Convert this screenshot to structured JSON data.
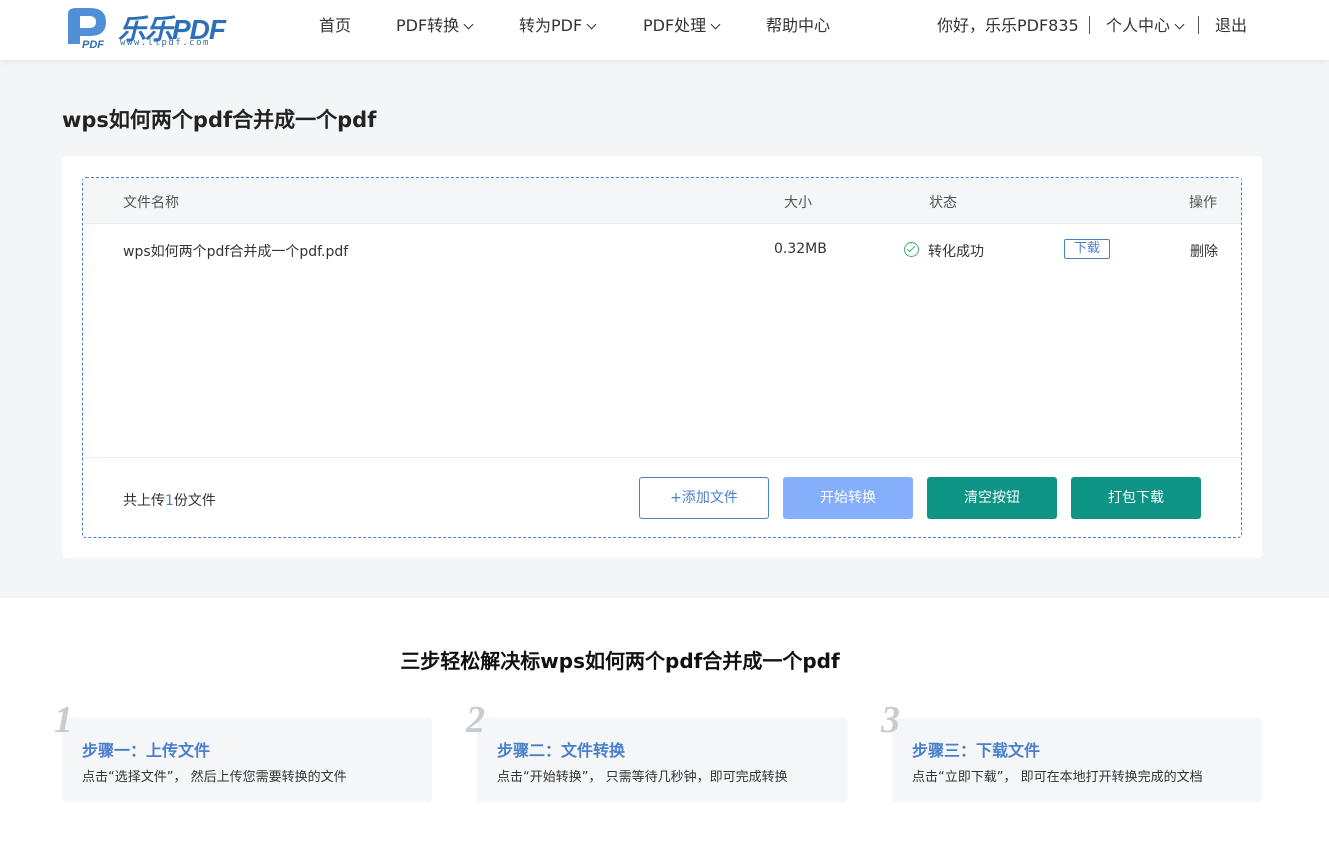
{
  "header": {
    "logo": {
      "text": "乐乐PDF",
      "url_text": "www.llpdf.com",
      "color": "#2d6fb8"
    },
    "nav": [
      {
        "label": "首页",
        "dropdown": false
      },
      {
        "label": "PDF转换",
        "dropdown": true
      },
      {
        "label": "转为PDF",
        "dropdown": true
      },
      {
        "label": "PDF处理",
        "dropdown": true
      },
      {
        "label": "帮助中心",
        "dropdown": false
      }
    ],
    "greeting": "你好，乐乐PDF835",
    "user_center": "个人中心",
    "logout": "退出"
  },
  "main": {
    "title": "wps如何两个pdf合并成一个pdf",
    "table": {
      "headers": {
        "name": "文件名称",
        "size": "大小",
        "status": "状态",
        "action": "操作"
      },
      "rows": [
        {
          "name": "wps如何两个pdf合并成一个pdf.pdf",
          "size": "0.32MB",
          "status": "转化成功",
          "download": "下载",
          "delete": "删除"
        }
      ]
    },
    "footer": {
      "count_prefix": "共上传",
      "count": "1",
      "count_suffix": "份文件",
      "buttons": {
        "add": "+添加文件",
        "start": "开始转换",
        "clear": "清空按钮",
        "pack": "打包下载"
      }
    }
  },
  "steps": {
    "title": "三步轻松解决标wps如何两个pdf合并成一个pdf",
    "items": [
      {
        "num": "1",
        "title": "步骤一：上传文件",
        "desc": "点击“选择文件”， 然后上传您需要转换的文件"
      },
      {
        "num": "2",
        "title": "步骤二：文件转换",
        "desc": "点击“开始转换”， 只需等待几秒钟，即可完成转换"
      },
      {
        "num": "3",
        "title": "步骤三：下载文件",
        "desc": "点击“立即下载”， 即可在本地打开转换完成的文档"
      }
    ]
  },
  "colors": {
    "accent": "#4a7fc9",
    "teal": "#0e9485",
    "light_blue": "#85aefb",
    "success": "#3db36a"
  }
}
